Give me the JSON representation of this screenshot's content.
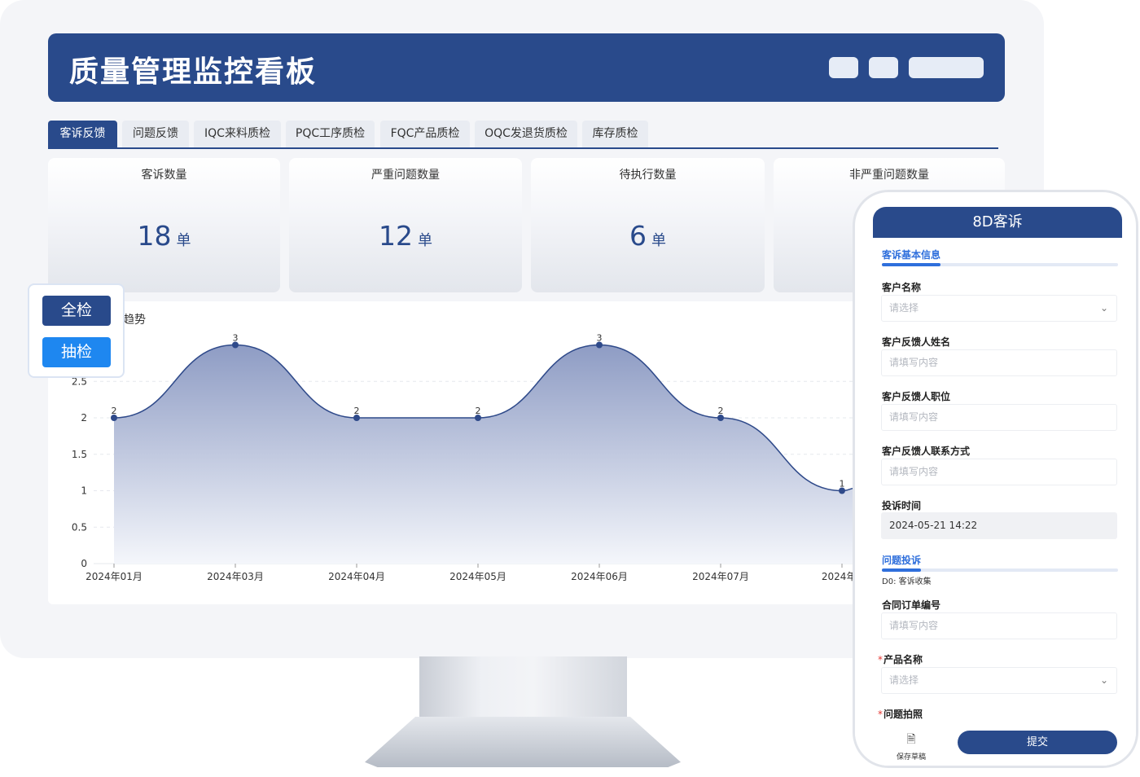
{
  "header": {
    "title": "质量管理监控看板"
  },
  "tabs": [
    {
      "label": "客诉反馈",
      "active": true
    },
    {
      "label": "问题反馈"
    },
    {
      "label": "IQC来料质检"
    },
    {
      "label": "PQC工序质检"
    },
    {
      "label": "FQC产品质检"
    },
    {
      "label": "OQC发退货质检"
    },
    {
      "label": "库存质检"
    }
  ],
  "kpis": [
    {
      "label": "客诉数量",
      "value": "18",
      "unit": "单"
    },
    {
      "label": "严重问题数量",
      "value": "12",
      "unit": "单"
    },
    {
      "label": "待执行数量",
      "value": "6",
      "unit": "单"
    },
    {
      "label": "非严重问题数量"
    }
  ],
  "chart_title_fragment": "趋势",
  "toggle": {
    "full_label": "全检",
    "sample_label": "抽检"
  },
  "chart_data": {
    "type": "area",
    "categories": [
      "2024年01月",
      "2024年03月",
      "2024年04月",
      "2024年05月",
      "2024年06月",
      "2024年07月",
      "2024年0"
    ],
    "values": [
      2,
      3,
      2,
      2,
      3,
      2,
      1
    ],
    "data_labels": [
      "2",
      "3",
      "2",
      "2",
      "3",
      "2",
      "1"
    ],
    "ylim": [
      0,
      3
    ],
    "yticks": [
      "0",
      "0.5",
      "1",
      "1.5",
      "2",
      "2.5"
    ],
    "grid": true,
    "colors": {
      "line": "#2f4a8a",
      "fill_top": "#8e9cc4",
      "fill_bottom": "#f4f6fb"
    }
  },
  "phone": {
    "title": "8D客诉",
    "section1": "客诉基本信息",
    "fields1": [
      {
        "label": "客户名称",
        "placeholder": "请选择",
        "select": true
      },
      {
        "label": "客户反馈人姓名",
        "placeholder": "请填写内容"
      },
      {
        "label": "客户反馈人职位",
        "placeholder": "请填写内容"
      },
      {
        "label": "客户反馈人联系方式",
        "placeholder": "请填写内容"
      },
      {
        "label": "投诉时间",
        "value": "2024-05-21 14:22"
      }
    ],
    "section2": "问题投诉",
    "d0_text": "D0: 客诉收集",
    "fields2": [
      {
        "label": "合同订单编号",
        "placeholder": "请填写内容"
      },
      {
        "label": "产品名称",
        "placeholder": "请选择",
        "select": true,
        "required": true
      },
      {
        "label": "问题拍照",
        "required": true
      }
    ],
    "save_label": "保存草稿",
    "submit_label": "提交"
  },
  "colors": {
    "primary": "#294a8b",
    "accent": "#2f6fdc",
    "toggle_active": "#1e87f0"
  }
}
